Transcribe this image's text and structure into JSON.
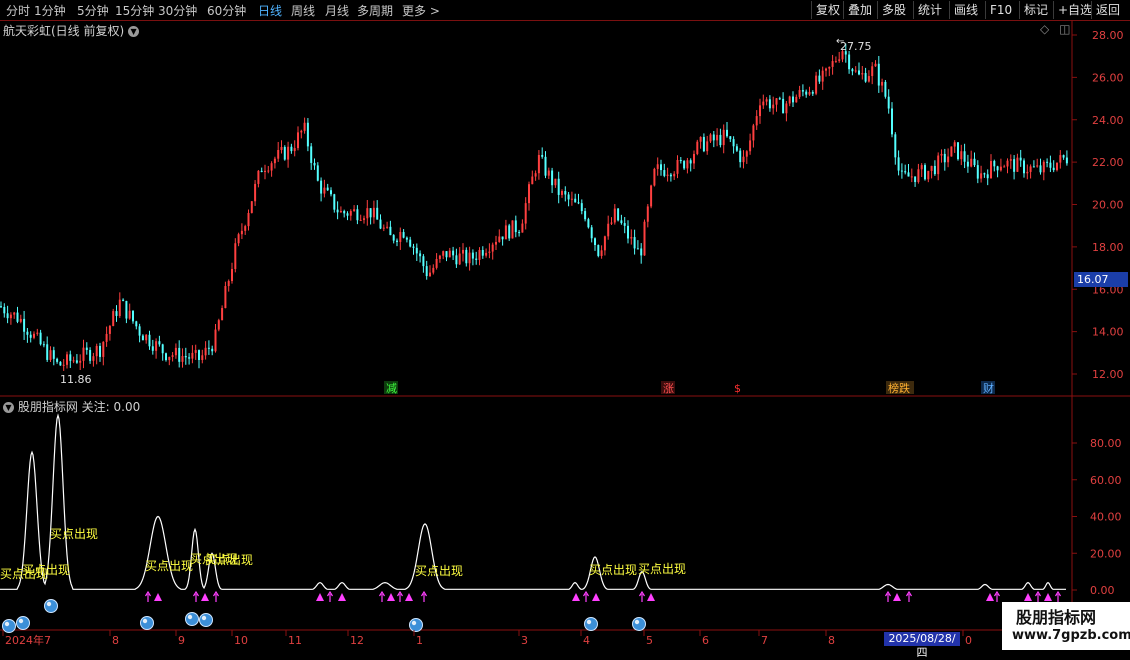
{
  "toolbar": {
    "periods": [
      "分时",
      "1分钟",
      "5分钟",
      "15分钟",
      "30分钟",
      "60分钟",
      "日线",
      "周线",
      "月线",
      "多周期",
      "更多 >"
    ],
    "active_period": "日线",
    "tools": [
      "复权",
      "叠加",
      "多股",
      "统计",
      "画线",
      "F10",
      "标记",
      "+自选",
      "返回"
    ]
  },
  "main_panel": {
    "title": "航天彩虹(日线 前复权)",
    "high_label": "27.75",
    "low_label": "11.86",
    "current_price": "16.07",
    "y_ticks": [
      "28.00",
      "26.00",
      "24.00",
      "22.00",
      "20.00",
      "18.00",
      "16.00",
      "14.00",
      "12.00"
    ],
    "event_tags": [
      "减",
      "涨",
      "$",
      "榜跌",
      "财"
    ],
    "colors": {
      "up": "#ff4040",
      "down": "#54ffff",
      "ma": "#ffffff"
    }
  },
  "indicator_panel": {
    "title": "股朋指标网 关注: 0.00",
    "y_ticks": [
      "80.00",
      "60.00",
      "40.00",
      "20.00",
      "0.00"
    ],
    "signal_label": "买点出现"
  },
  "x_axis": {
    "labels": [
      "2024年7",
      "8",
      "9",
      "10",
      "11",
      "12",
      "1",
      "3",
      "4",
      "5",
      "6",
      "7",
      "8",
      "0"
    ],
    "cursor_date": "2025/08/28/四"
  },
  "watermark": {
    "title": "股朋指标网",
    "url": "www.7gpzb.com"
  }
}
